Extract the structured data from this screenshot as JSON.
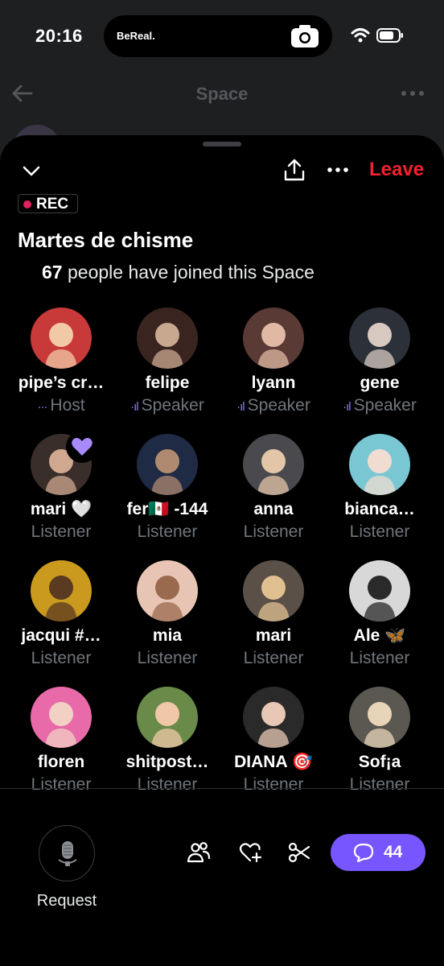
{
  "status_bar": {
    "time": "20:16",
    "app_name": "BeReal."
  },
  "background": {
    "title": "Space"
  },
  "header": {
    "leave_label": "Leave"
  },
  "space": {
    "rec_label": "REC",
    "title": "Martes de chisme",
    "joined_count": "67",
    "joined_text": "people have joined this Space"
  },
  "participants": [
    {
      "name": "pipe’s cr…",
      "role": "Host",
      "colors": [
        "#c83a3a",
        "#f2c9a8"
      ]
    },
    {
      "name": "felipe",
      "role": "Speaker",
      "colors": [
        "#3a2420",
        "#c9a890"
      ]
    },
    {
      "name": "lyann",
      "role": "Speaker",
      "colors": [
        "#5a3a34",
        "#e0b8a4"
      ]
    },
    {
      "name": "gene",
      "role": "Speaker",
      "colors": [
        "#2c3038",
        "#d8c9c0"
      ]
    },
    {
      "name": "mari 🤍",
      "role": "Listener",
      "colors": [
        "#3a2e2a",
        "#cfa88f"
      ]
    },
    {
      "name": "fer🇲🇽 -144",
      "role": "Listener",
      "colors": [
        "#1f2a44",
        "#b08a70"
      ]
    },
    {
      "name": "anna",
      "role": "Listener",
      "colors": [
        "#4a4a4e",
        "#e3c6a8"
      ]
    },
    {
      "name": "bianca…",
      "role": "Listener",
      "colors": [
        "#7ac7d4",
        "#f0dcd0"
      ]
    },
    {
      "name": "jacqui #…",
      "role": "Listener",
      "colors": [
        "#c99a1e",
        "#5a3a20"
      ]
    },
    {
      "name": "mia",
      "role": "Listener",
      "colors": [
        "#e8c4b4",
        "#9a6a4e"
      ]
    },
    {
      "name": "mari",
      "role": "Listener",
      "colors": [
        "#5a5048",
        "#e0c090"
      ]
    },
    {
      "name": "Ale 🦋",
      "role": "Listener",
      "colors": [
        "#d8d8d8",
        "#2a2a2a"
      ]
    },
    {
      "name": "floren",
      "role": "Listener",
      "colors": [
        "#e86aa8",
        "#f2d0c4"
      ]
    },
    {
      "name": "shitpost…",
      "role": "Listener",
      "colors": [
        "#6a8a4a",
        "#f0c8a8"
      ]
    },
    {
      "name": "DIANA 🎯",
      "role": "Listener",
      "colors": [
        "#2a2a2a",
        "#e8c8b4"
      ]
    },
    {
      "name": "Sof¡a",
      "role": "Listener",
      "colors": [
        "#5a5850",
        "#e8d4b8"
      ]
    }
  ],
  "footer": {
    "request_label": "Request",
    "chat_count": "44"
  },
  "colors": {
    "accent": "#7856ff",
    "leave": "#f4212e",
    "rec_dot": "#e0245e",
    "muted": "#71767b",
    "reaction": "#a78bfa"
  },
  "icons": [
    "camera-icon",
    "wifi-icon",
    "battery-icon",
    "back-arrow-icon",
    "more-icon",
    "chevron-down-icon",
    "share-icon",
    "purple-heart-icon",
    "microphone-icon",
    "people-icon",
    "heart-plus-icon",
    "scissors-icon",
    "chat-bubble-icon"
  ]
}
